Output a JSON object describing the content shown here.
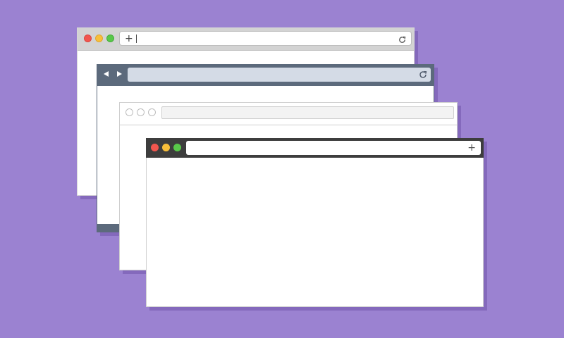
{
  "colors": {
    "background": "#9b82d1",
    "close": "#f2564e",
    "minimize": "#f8bf3a",
    "maximize": "#58c84a",
    "slate_chrome": "#5c6a7c",
    "dark_chrome": "#3d3d3d"
  },
  "windows": [
    {
      "theme": "light-grey",
      "icons": [
        "close-dot",
        "minimize-dot",
        "maximize-dot",
        "plus-icon",
        "reload-icon"
      ],
      "address_bar": {
        "value": ""
      }
    },
    {
      "theme": "slate",
      "icons": [
        "back-arrow-icon",
        "forward-arrow-icon",
        "reload-icon"
      ],
      "address_bar": {
        "value": ""
      }
    },
    {
      "theme": "white-outline",
      "icons": [
        "circle-outline-icon",
        "circle-outline-icon",
        "circle-outline-icon"
      ],
      "address_bar": {
        "value": ""
      }
    },
    {
      "theme": "dark",
      "icons": [
        "close-dot",
        "minimize-dot",
        "maximize-dot",
        "plus-icon"
      ],
      "address_bar": {
        "value": ""
      }
    }
  ],
  "glyphs": {
    "plus": "+"
  }
}
